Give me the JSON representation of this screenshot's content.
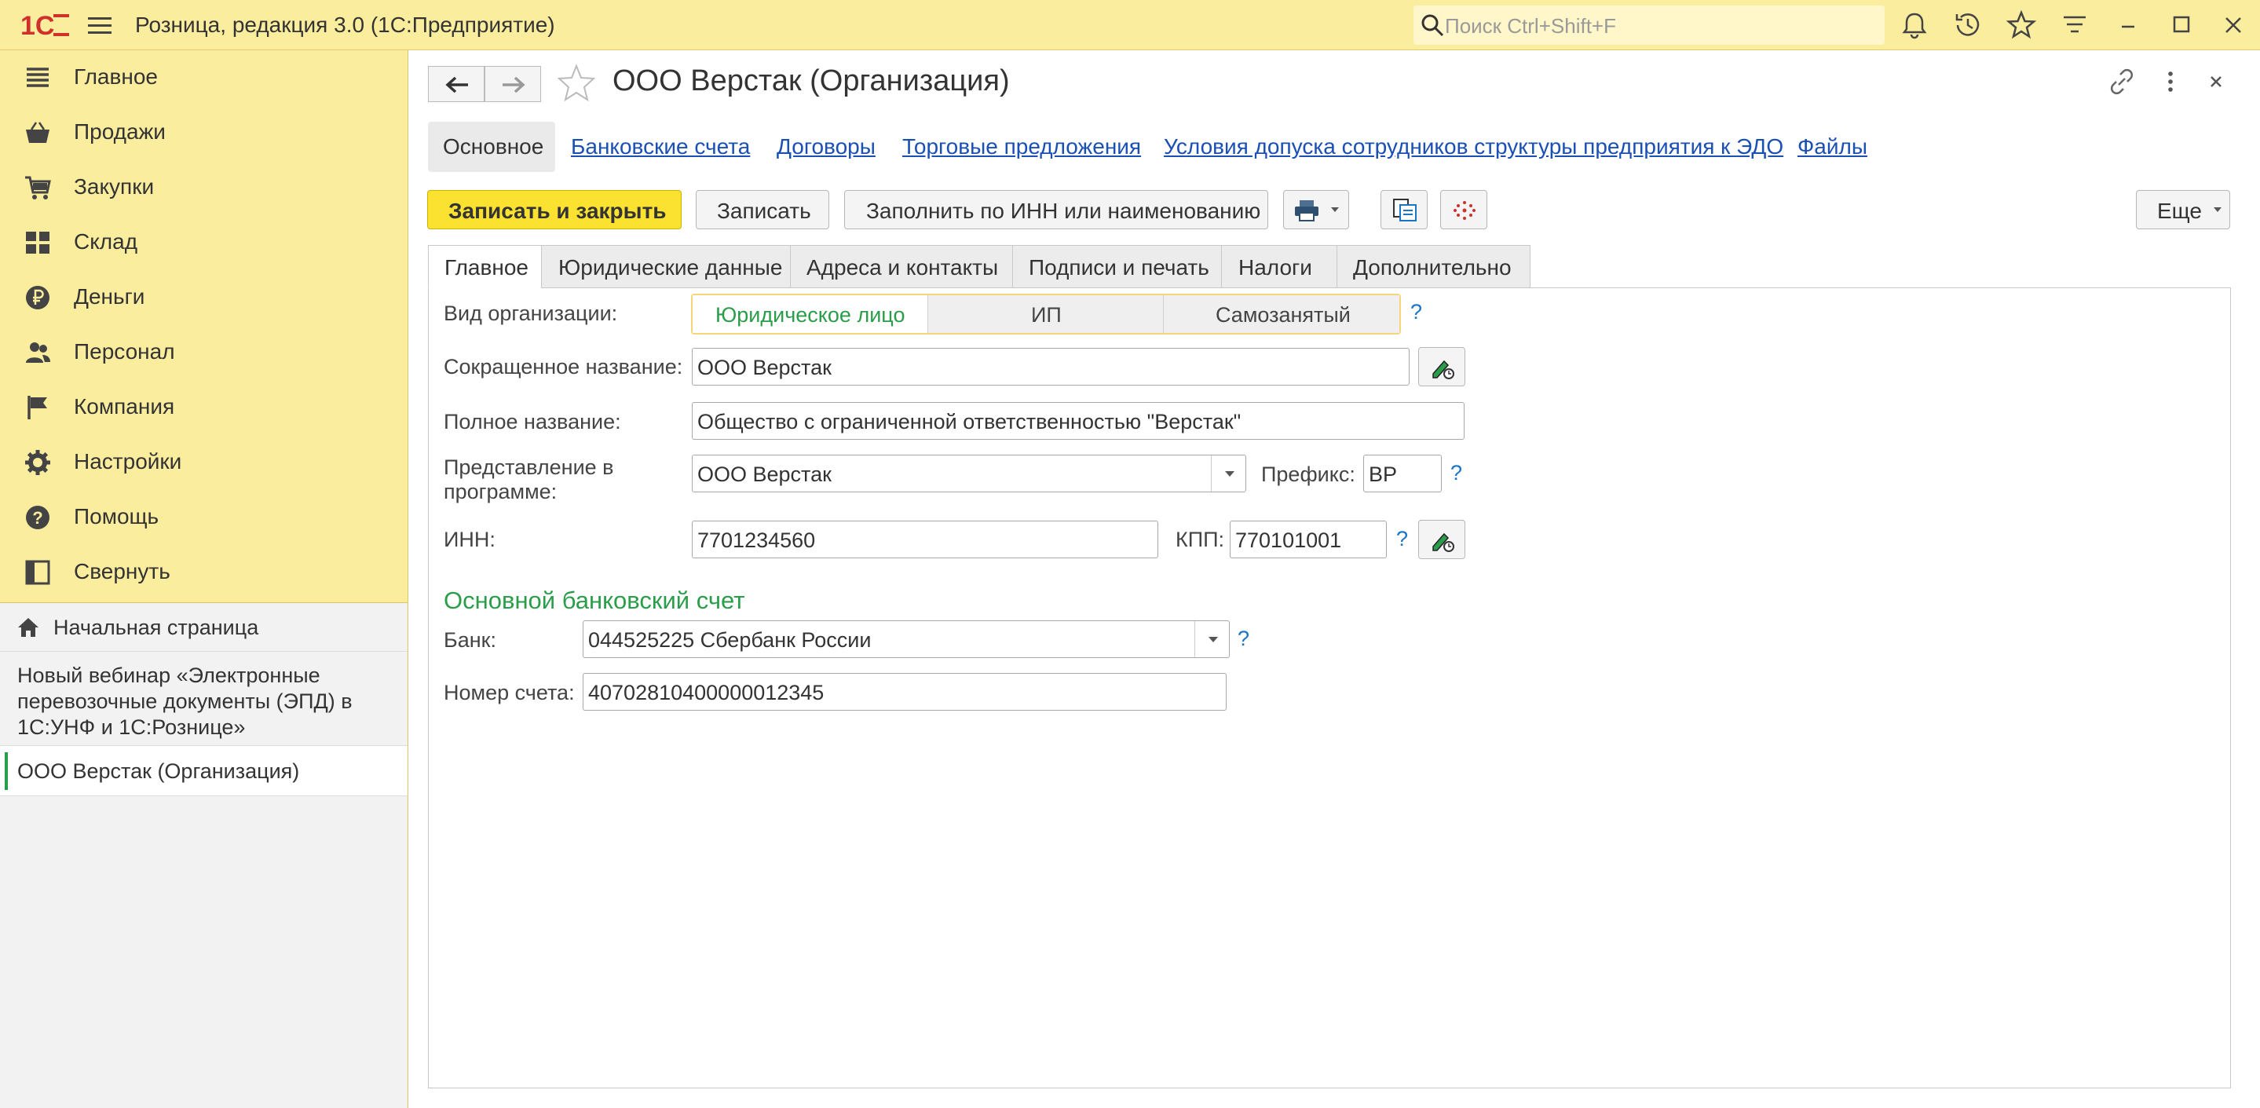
{
  "app": {
    "title": "Розница, редакция 3.0  (1С:Предприятие)",
    "search_placeholder": "Поиск Ctrl+Shift+F",
    "logo_text": "1С"
  },
  "sidebar": {
    "items": [
      {
        "label": "Главное",
        "icon": "list-icon"
      },
      {
        "label": "Продажи",
        "icon": "basket-icon"
      },
      {
        "label": "Закупки",
        "icon": "cart-icon"
      },
      {
        "label": "Склад",
        "icon": "warehouse-icon"
      },
      {
        "label": "Деньги",
        "icon": "ruble-icon"
      },
      {
        "label": "Персонал",
        "icon": "people-icon"
      },
      {
        "label": "Компания",
        "icon": "flag-icon"
      },
      {
        "label": "Настройки",
        "icon": "gear-icon"
      },
      {
        "label": "Помощь",
        "icon": "help-icon"
      },
      {
        "label": "Свернуть",
        "icon": "collapse-icon"
      }
    ]
  },
  "open_windows": {
    "home": "Начальная страница",
    "webinar": "Новый вебинар «Электронные перевозочные документы (ЭПД) в 1С:УНФ и 1С:Рознице»",
    "current": "ООО Верстак (Организация)"
  },
  "form": {
    "title": "ООО Верстак (Организация)",
    "sections": {
      "main": "Основное",
      "bank_accounts": "Банковские счета",
      "contracts": "Договоры",
      "trade_offers": "Торговые предложения",
      "edo_access": "Условия допуска сотрудников структуры предприятия к ЭДО",
      "files": "Файлы"
    },
    "buttons": {
      "save_close": "Записать и закрыть",
      "save": "Записать",
      "fill_inn": "Заполнить по ИНН или наименованию",
      "more": "Еще"
    },
    "tabs": [
      "Главное",
      "Юридические данные",
      "Адреса и контакты",
      "Подписи и печать",
      "Налоги",
      "Дополнительно"
    ],
    "fields": {
      "org_type_label": "Вид организации:",
      "org_types": [
        "Юридическое лицо",
        "ИП",
        "Самозанятый"
      ],
      "short_name_label": "Сокращенное название:",
      "short_name": "ООО Верстак",
      "full_name_label": "Полное название:",
      "full_name": "Общество с ограниченной ответственностью \"Верстак\"",
      "display_label": "Представление в программе:",
      "display": "ООО Верстак",
      "prefix_label": "Префикс:",
      "prefix": "ВР",
      "inn_label": "ИНН:",
      "inn": "7701234560",
      "kpp_label": "КПП:",
      "kpp": "770101001",
      "help": "?"
    },
    "bank": {
      "group_title": "Основной банковский счет",
      "bank_label": "Банк:",
      "bank": "044525225 Сбербанк России",
      "account_label": "Номер счета:",
      "account": "40702810400000012345"
    }
  },
  "colors": {
    "panel": "#fbed9e",
    "primary_button": "#fbe230",
    "link": "#1a4fb4",
    "accent_green": "#2a9d4a"
  }
}
